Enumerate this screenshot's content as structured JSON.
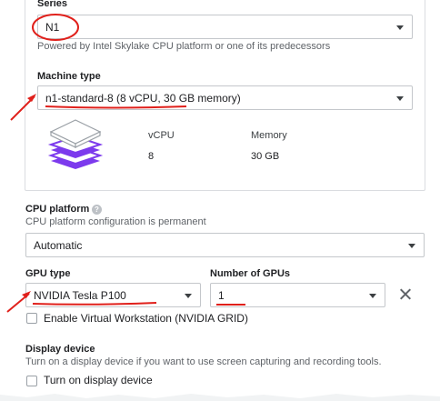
{
  "series": {
    "label": "Series",
    "value": "N1",
    "help": "Powered by Intel Skylake CPU platform or one of its predecessors"
  },
  "machine_type": {
    "label": "Machine type",
    "value": "n1-standard-8 (8 vCPU, 30 GB memory)",
    "vcpu_header": "vCPU",
    "memory_header": "Memory",
    "vcpu_value": "8",
    "memory_value": "30 GB"
  },
  "cpu_platform": {
    "label": "CPU platform",
    "help": "CPU platform configuration is permanent",
    "value": "Automatic"
  },
  "gpu": {
    "type_label": "GPU type",
    "type_value": "NVIDIA Tesla P100",
    "count_label": "Number of GPUs",
    "count_value": "1",
    "virtual_ws_label": "Enable Virtual Workstation (NVIDIA GRID)"
  },
  "display_device": {
    "label": "Display device",
    "help": "Turn on a display device if you want to use screen capturing and recording tools.",
    "checkbox_label": "Turn on display device"
  },
  "colors": {
    "annotation_red": "#e0201b",
    "stack_purple": "#7c3aed",
    "border": "#c4c7cb"
  },
  "icons": {
    "machine_icon": "stacked-layers-icon",
    "help_icon": "question-mark-icon",
    "remove_icon": "close-icon"
  }
}
